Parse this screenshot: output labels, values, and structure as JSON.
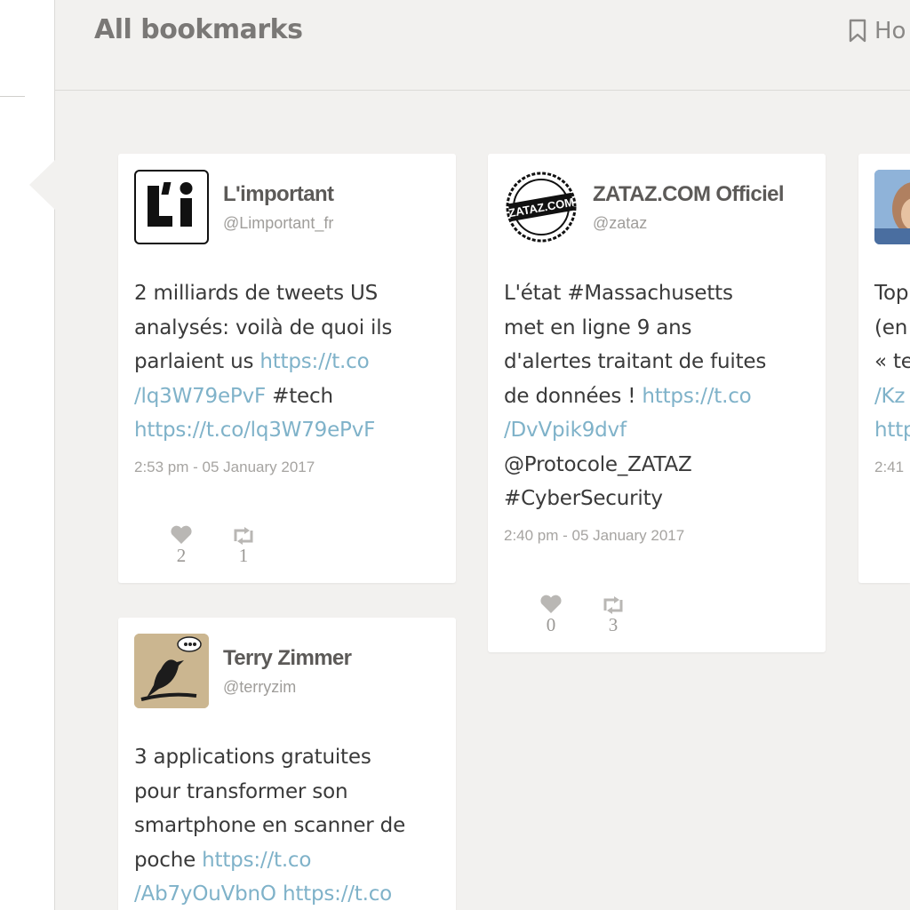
{
  "header": {
    "title": "All bookmarks",
    "link_label": "Ho"
  },
  "colors": {
    "background": "#f2f1ef",
    "card": "#ffffff",
    "link": "#7fb2c9",
    "title": "#7a7876"
  },
  "cards": [
    {
      "name": "L'important",
      "handle": "@Limportant_fr",
      "avatar_icon": "limportant-logo",
      "text_before": "2 milliards de tweets US\nanalysés: voilà de quoi ils\nparlaient us ",
      "link1": "https://t.co\n/lq3W79ePvF",
      "text_mid": " #tech\n",
      "link2": "https://t.co/lq3W79ePvF",
      "text_after": "",
      "timestamp": "2:53 pm - 05 January 2017",
      "likes": "2",
      "retweets": "1"
    },
    {
      "name": "ZATAZ.COM Officiel",
      "handle": "@zataz",
      "avatar_icon": "zataz-logo",
      "avatar_text": "ZATAZ.COM",
      "text_before": "L'état #Massachusetts\nmet en ligne 9 ans\nd'alertes traitant de fuites\nde données ! ",
      "link1": "https://t.co\n/DvVpik9dvf",
      "text_mid": "\n@Protocole_ZATAZ\n#CyberSecurity",
      "link2": "",
      "text_after": "",
      "timestamp": "2:40 pm - 05 January 2017",
      "likes": "0",
      "retweets": "3"
    },
    {
      "name": "",
      "handle": "",
      "avatar_icon": "person-photo",
      "text_before": "Top\n(en\n« te\n",
      "link1": "/Kz\nhttp",
      "text_mid": "",
      "link2": "",
      "text_after": "",
      "timestamp": "2:41"
    },
    {
      "name": "Terry Zimmer",
      "handle": "@terryzim",
      "avatar_icon": "bird-avatar",
      "text_before": "3 applications gratuites\npour transformer son\nsmartphone en scanner de\npoche ",
      "link1": "https://t.co\n/Ab7yOuVbnO",
      "text_mid": " ",
      "link2": "https://t.co",
      "text_after": ""
    }
  ]
}
